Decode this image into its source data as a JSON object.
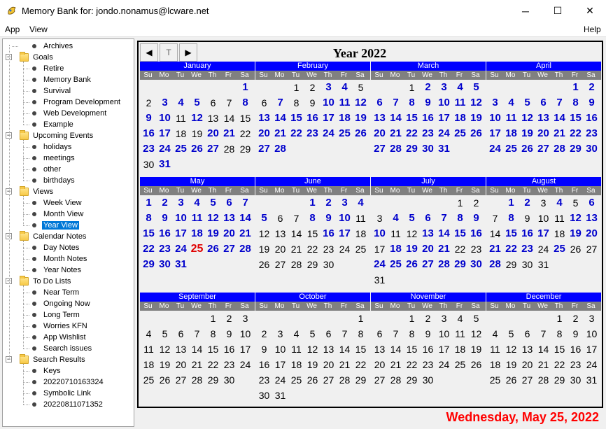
{
  "window": {
    "title": "Memory Bank for: jondo.nonamus@lcware.net",
    "min": "─",
    "max": "☐",
    "close": "✕"
  },
  "menu": {
    "app": "App",
    "view": "View",
    "help": "Help"
  },
  "tree": [
    {
      "label": "Archives",
      "level": 1,
      "kind": "leaf"
    },
    {
      "label": "Goals",
      "level": 0,
      "kind": "folder"
    },
    {
      "label": "Retire",
      "level": 1,
      "kind": "leaf"
    },
    {
      "label": "Memory Bank",
      "level": 1,
      "kind": "leaf"
    },
    {
      "label": "Survival",
      "level": 1,
      "kind": "leaf"
    },
    {
      "label": "Program Development",
      "level": 1,
      "kind": "leaf"
    },
    {
      "label": "Web Development",
      "level": 1,
      "kind": "leaf"
    },
    {
      "label": "Example",
      "level": 1,
      "kind": "leaf"
    },
    {
      "label": "Upcoming Events",
      "level": 0,
      "kind": "folder"
    },
    {
      "label": "holidays",
      "level": 1,
      "kind": "leaf"
    },
    {
      "label": "meetings",
      "level": 1,
      "kind": "leaf"
    },
    {
      "label": "other",
      "level": 1,
      "kind": "leaf"
    },
    {
      "label": "birthdays",
      "level": 1,
      "kind": "leaf"
    },
    {
      "label": "Views",
      "level": 0,
      "kind": "folder"
    },
    {
      "label": "Week View",
      "level": 1,
      "kind": "leaf"
    },
    {
      "label": "Month View",
      "level": 1,
      "kind": "leaf"
    },
    {
      "label": "Year View",
      "level": 1,
      "kind": "leaf",
      "selected": true
    },
    {
      "label": "Calendar Notes",
      "level": 0,
      "kind": "folder"
    },
    {
      "label": "Day Notes",
      "level": 1,
      "kind": "leaf"
    },
    {
      "label": "Month Notes",
      "level": 1,
      "kind": "leaf"
    },
    {
      "label": "Year Notes",
      "level": 1,
      "kind": "leaf"
    },
    {
      "label": "To Do Lists",
      "level": 0,
      "kind": "folder"
    },
    {
      "label": "Near Term",
      "level": 1,
      "kind": "leaf"
    },
    {
      "label": "Ongoing Now",
      "level": 1,
      "kind": "leaf"
    },
    {
      "label": "Long Term",
      "level": 1,
      "kind": "leaf"
    },
    {
      "label": "Worries KFN",
      "level": 1,
      "kind": "leaf"
    },
    {
      "label": "App Wishlist",
      "level": 1,
      "kind": "leaf"
    },
    {
      "label": "Search issues",
      "level": 1,
      "kind": "leaf"
    },
    {
      "label": "Search Results",
      "level": 0,
      "kind": "folder"
    },
    {
      "label": "Keys",
      "level": 1,
      "kind": "leaf"
    },
    {
      "label": "20220710163324",
      "level": 1,
      "kind": "leaf"
    },
    {
      "label": "Symbolic Link",
      "level": 1,
      "kind": "leaf"
    },
    {
      "label": "20220811071352",
      "level": 1,
      "kind": "leaf"
    }
  ],
  "calendar": {
    "nav": {
      "prev": "◀",
      "today": "T",
      "next": "▶"
    },
    "title": "Year 2022",
    "weekdays": [
      "Su",
      "Mo",
      "Tu",
      "We",
      "Th",
      "Fr",
      "Sa"
    ],
    "status": "Wednesday, May 25, 2022",
    "today": {
      "month": 4,
      "day": 25
    },
    "months": [
      {
        "name": "January",
        "start": 6,
        "days": 31,
        "hi": [
          1,
          3,
          4,
          5,
          8,
          9,
          10,
          12,
          16,
          17,
          20,
          21,
          23,
          24,
          25,
          26,
          27,
          31
        ]
      },
      {
        "name": "February",
        "start": 2,
        "days": 28,
        "hi": [
          3,
          4,
          7,
          10,
          11,
          12,
          13,
          14,
          15,
          16,
          17,
          18,
          19,
          20,
          21,
          22,
          23,
          24,
          25,
          26,
          27,
          28
        ]
      },
      {
        "name": "March",
        "start": 2,
        "days": 31,
        "hi": [
          2,
          3,
          4,
          5,
          6,
          7,
          8,
          9,
          10,
          11,
          12,
          13,
          14,
          15,
          16,
          17,
          18,
          19,
          20,
          21,
          22,
          23,
          24,
          25,
          26,
          27,
          28,
          29,
          30,
          31
        ]
      },
      {
        "name": "April",
        "start": 5,
        "days": 30,
        "hi": [
          1,
          2,
          3,
          4,
          5,
          6,
          7,
          8,
          9,
          10,
          11,
          12,
          13,
          14,
          15,
          16,
          17,
          18,
          19,
          20,
          21,
          22,
          23,
          24,
          25,
          26,
          27,
          28,
          29,
          30
        ]
      },
      {
        "name": "May",
        "start": 0,
        "days": 31,
        "hi": [
          1,
          2,
          3,
          4,
          5,
          6,
          7,
          8,
          9,
          10,
          11,
          12,
          13,
          14,
          15,
          16,
          17,
          18,
          19,
          20,
          21,
          22,
          23,
          24,
          26,
          27,
          28,
          29,
          30,
          31
        ]
      },
      {
        "name": "June",
        "start": 3,
        "days": 30,
        "hi": [
          1,
          2,
          3,
          4,
          5,
          8,
          9,
          10,
          16,
          17
        ]
      },
      {
        "name": "July",
        "start": 5,
        "days": 31,
        "hi": [
          4,
          5,
          6,
          7,
          8,
          9,
          10,
          13,
          14,
          15,
          16,
          18,
          19,
          20,
          21,
          24,
          25,
          26,
          27,
          28,
          29,
          30
        ]
      },
      {
        "name": "August",
        "start": 1,
        "days": 31,
        "hi": [
          1,
          2,
          4,
          6,
          8,
          12,
          13,
          15,
          16,
          17,
          19,
          20,
          21,
          22,
          23,
          25,
          28
        ]
      },
      {
        "name": "September",
        "start": 4,
        "days": 30,
        "hi": []
      },
      {
        "name": "October",
        "start": 6,
        "days": 31,
        "hi": []
      },
      {
        "name": "November",
        "start": 2,
        "days": 30,
        "hi": []
      },
      {
        "name": "December",
        "start": 4,
        "days": 31,
        "hi": []
      }
    ]
  }
}
